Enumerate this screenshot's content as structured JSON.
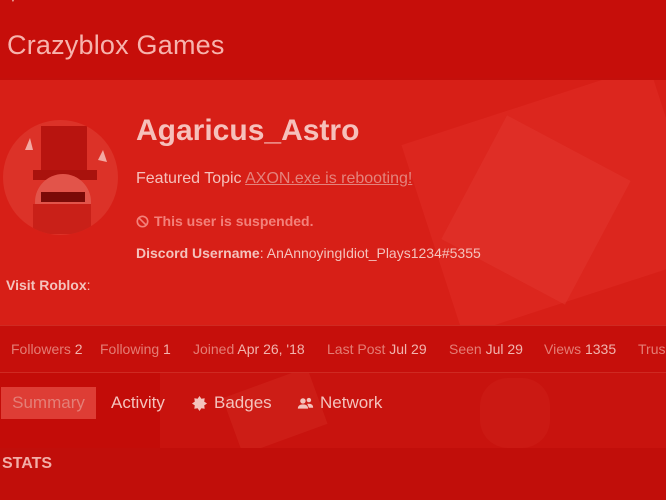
{
  "header": {
    "site_title": "Crazyblox Games"
  },
  "profile": {
    "username": "Agaricus_Astro",
    "featured_topic_label": "Featured Topic",
    "featured_topic_link": "AXON.exe is rebooting!",
    "suspended_text": "This user is suspended.",
    "discord_label": "Discord Username",
    "discord_value": ": AnAnnoyingIdiot_Plays1234#5355",
    "roblox_label": "Visit Roblox",
    "roblox_colon": ":"
  },
  "stats": [
    {
      "label": "Followers",
      "value": "2"
    },
    {
      "label": "Following",
      "value": "1"
    },
    {
      "label": "Joined",
      "value": "Apr 26, '18"
    },
    {
      "label": "Last Post",
      "value": "Jul 29"
    },
    {
      "label": "Seen",
      "value": "Jul 29"
    },
    {
      "label": "Views",
      "value": "1335"
    },
    {
      "label": "Trus",
      "value": ""
    }
  ],
  "tabs": [
    {
      "label": "Summary",
      "icon": ""
    },
    {
      "label": "Activity",
      "icon": ""
    },
    {
      "label": "Badges",
      "icon": "badge-icon"
    },
    {
      "label": "Network",
      "icon": "users-icon"
    }
  ],
  "section": {
    "heading": "STATS"
  },
  "colors": {
    "background": "#c40f0b",
    "accent_link": "#e4837c",
    "suspended": "#f3817a"
  }
}
